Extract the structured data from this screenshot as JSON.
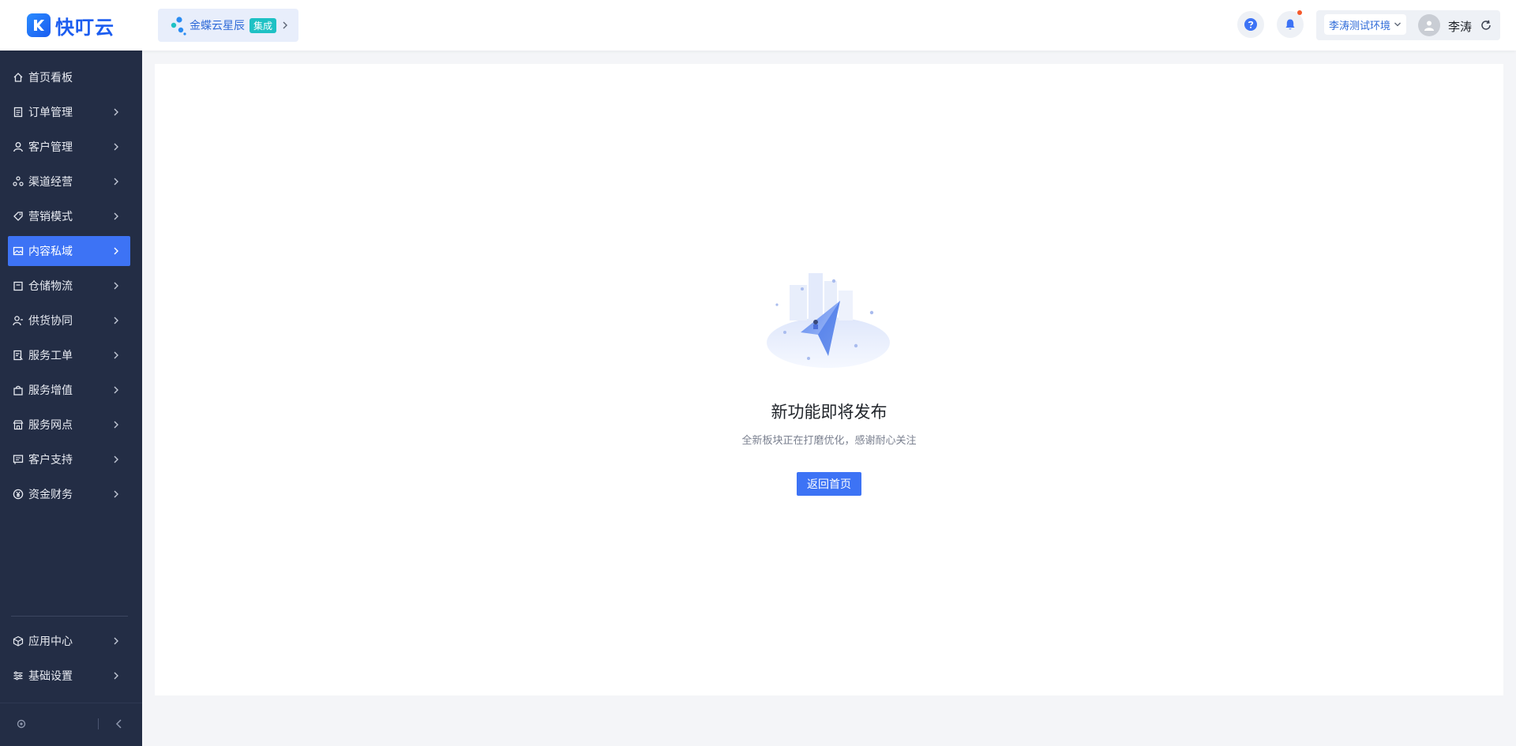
{
  "brand": {
    "name": "快叮云"
  },
  "integration": {
    "name": "金蝶云星辰",
    "badge": "集成"
  },
  "header": {
    "environment": "李涛测试环境",
    "user_name": "李涛"
  },
  "sidebar": {
    "items": [
      {
        "label": "首页看板",
        "icon": "home-icon"
      },
      {
        "label": "订单管理",
        "icon": "order-icon"
      },
      {
        "label": "客户管理",
        "icon": "user-icon"
      },
      {
        "label": "渠道经营",
        "icon": "channel-icon"
      },
      {
        "label": "营销模式",
        "icon": "tag-icon"
      },
      {
        "label": "内容私域",
        "icon": "image-icon",
        "active": true
      },
      {
        "label": "仓储物流",
        "icon": "warehouse-icon"
      },
      {
        "label": "供货协同",
        "icon": "supplier-icon"
      },
      {
        "label": "服务工单",
        "icon": "workorder-icon"
      },
      {
        "label": "服务增值",
        "icon": "bag-icon"
      },
      {
        "label": "服务网点",
        "icon": "store-icon"
      },
      {
        "label": "客户支持",
        "icon": "support-icon"
      },
      {
        "label": "资金财务",
        "icon": "yuan-icon"
      }
    ],
    "bottom_items": [
      {
        "label": "应用中心",
        "icon": "cube-icon"
      },
      {
        "label": "基础设置",
        "icon": "settings-icon"
      }
    ]
  },
  "empty_state": {
    "title": "新功能即将发布",
    "description": "全新板块正在打磨优化，感谢耐心关注",
    "button": "返回首页"
  },
  "colors": {
    "accent": "#3d73f5",
    "sidebar_bg": "#232d45",
    "brand": "#1c5df0",
    "badge": "#1ec1c4"
  }
}
